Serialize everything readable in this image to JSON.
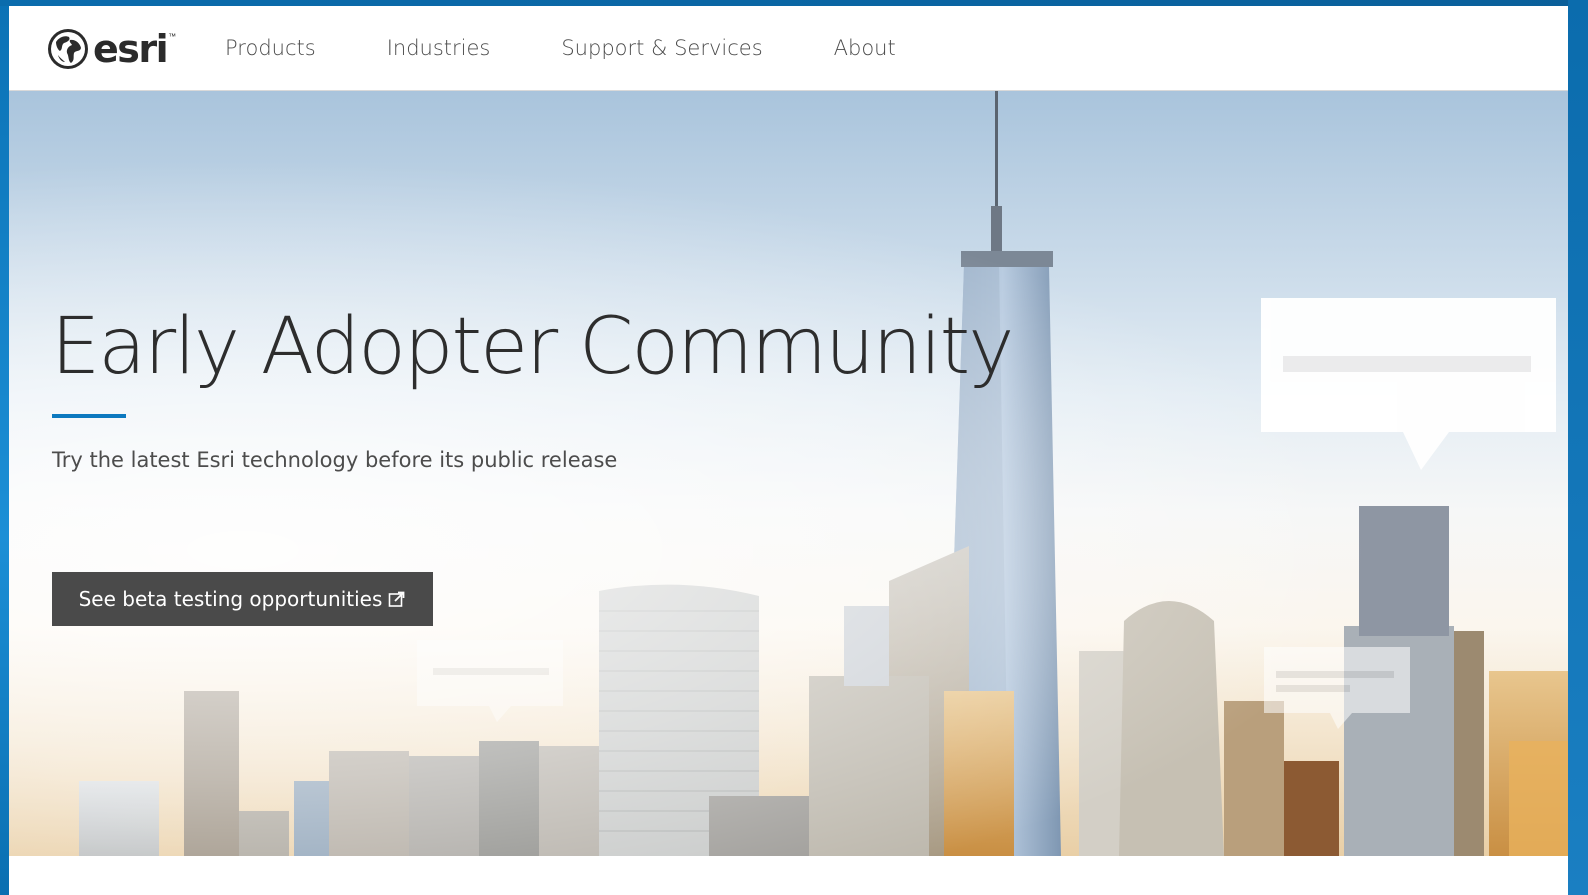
{
  "brand": {
    "logo_text": "esri",
    "logo_icon": "globe-icon",
    "trademark": "™"
  },
  "nav": {
    "items": [
      {
        "label": "Products"
      },
      {
        "label": "Industries"
      },
      {
        "label": "Support & Services"
      },
      {
        "label": "About"
      }
    ]
  },
  "hero": {
    "title": "Early Adopter Community",
    "subtitle": "Try the latest Esri technology before its public release",
    "cta_label": "See beta testing opportunities",
    "cta_icon": "external-link-icon"
  },
  "colors": {
    "accent": "#0c79bf",
    "button_bg": "#4a4a4a",
    "frame": "#0b72b5"
  }
}
